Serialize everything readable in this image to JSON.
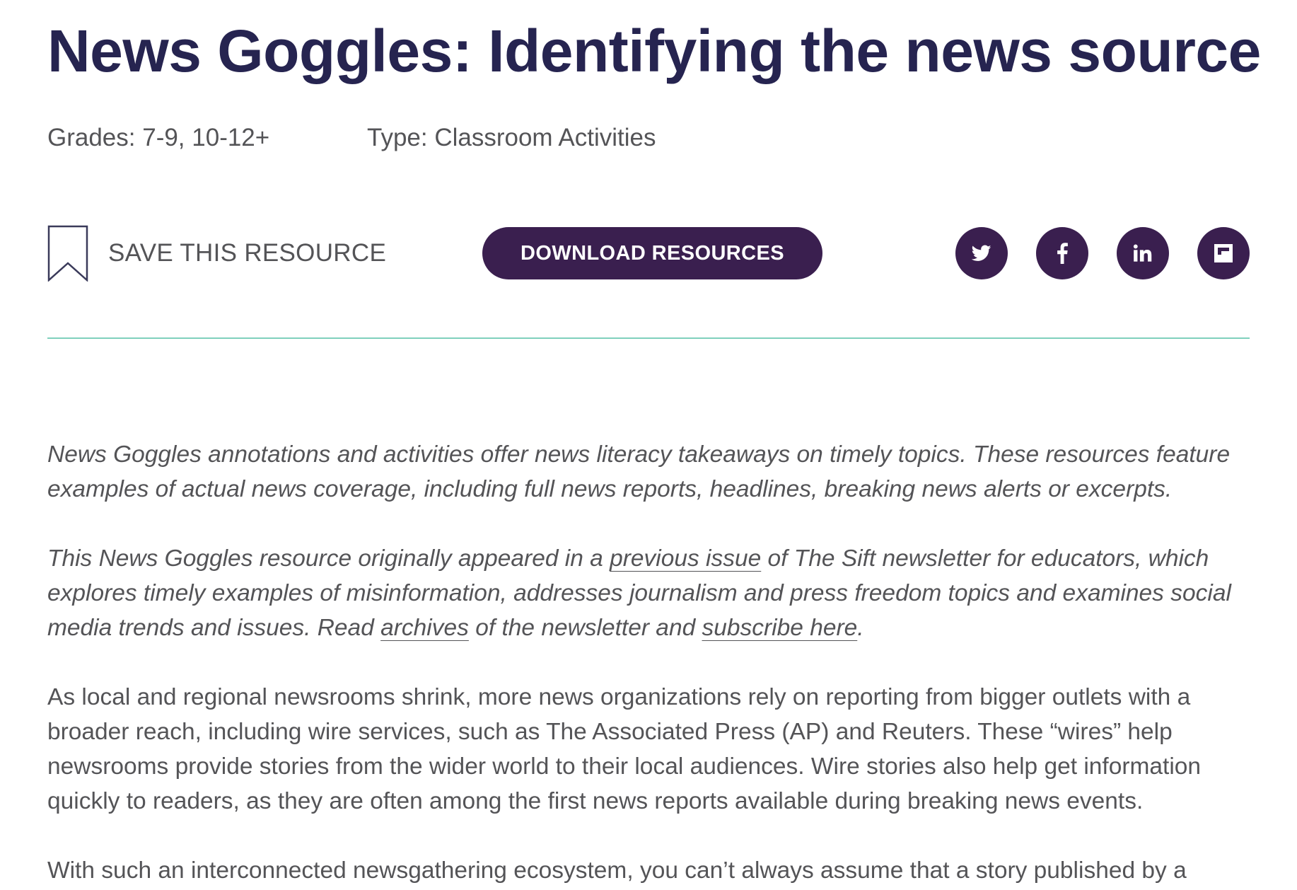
{
  "page": {
    "title": "News Goggles: Identifying the news source"
  },
  "meta": {
    "grades": "Grades: 7-9, 10-12+",
    "type": "Type: Classroom Activities"
  },
  "actions": {
    "save_label": "SAVE THIS RESOURCE",
    "download_label": "DOWNLOAD RESOURCES"
  },
  "social": [
    {
      "icon": "twitter-icon"
    },
    {
      "icon": "facebook-icon"
    },
    {
      "icon": "linkedin-icon"
    },
    {
      "icon": "flipboard-icon"
    }
  ],
  "colors": {
    "title": "#262450",
    "button": "#3a1f4f",
    "divider": "#7fd1bd",
    "text": "#545457"
  },
  "content": {
    "p1": "News Goggles annotations and activities offer news literacy takeaways on timely topics. These resources feature examples of actual news coverage, including full news reports, headlines, breaking news alerts or excerpts.",
    "p2_a": "This News Goggles resource originally appeared in a ",
    "p2_link1": "previous issue",
    "p2_b": " of The Sift newsletter for educators, which explores timely examples of misinformation, addresses journalism and press freedom topics and examines social media trends and issues. Read ",
    "p2_link2": "archives",
    "p2_c": " of the newsletter and ",
    "p2_link3": "subscribe here",
    "p2_d": ".",
    "p3": "As local and regional newsrooms shrink, more news organizations rely on reporting from bigger outlets with a broader reach, including wire services, such as The Associated Press (AP) and Reuters. These “wires” help newsrooms provide stories from the wider world to their local audiences. Wire stories also help get information quickly to readers, as they are often among the first news reports available during breaking news events.",
    "p4": "With such an interconnected newsgathering ecosystem, you can’t always assume that a story published by a"
  }
}
